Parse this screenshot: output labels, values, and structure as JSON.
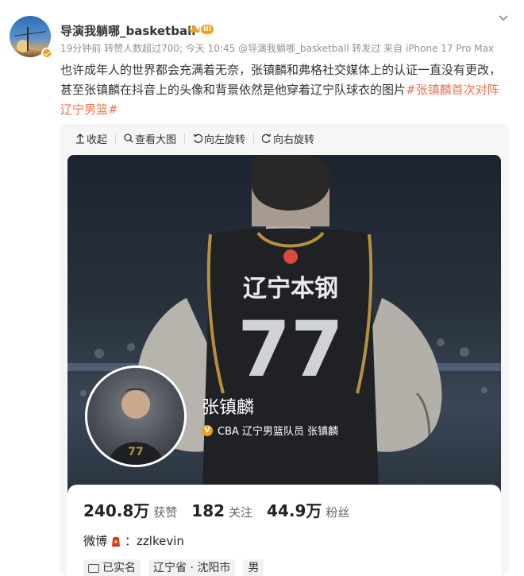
{
  "post": {
    "username": "导演我躺哪_basketball",
    "level_badge": "III",
    "meta": "19分钟前 转赞人数超过700; 今天 10:45 @导演我躺哪_basketball 转发过  来自 iPhone 17 Pro Max",
    "text": "也许成年人的世界都会充满着无奈，张镇麟和弗格社交媒体上的认证一直没有更改，甚至张镇麟在抖音上的头像和背景依然是他穿着辽宁队球衣的图片",
    "hashtag": "#张镇麟首次对阵辽宁男篮#"
  },
  "toolbar": {
    "collapse": "收起",
    "view_large": "查看大图",
    "rotate_left": "向左旋转",
    "rotate_right": "向右旋转"
  },
  "jersey": {
    "team_text": "辽宁本钢",
    "number": "77"
  },
  "profile": {
    "name": "张镇麟",
    "verification": "CBA 辽宁男篮队员 张镇麟",
    "stats": [
      {
        "value": "240.8万",
        "label": "获赞"
      },
      {
        "value": "182",
        "label": "关注"
      },
      {
        "value": "44.9万",
        "label": "粉丝"
      }
    ],
    "weibo_label": "微博",
    "weibo_id": "zzlkevin",
    "tags": [
      "已实名",
      "辽宁省 · 沈阳市",
      "男"
    ]
  },
  "colors": {
    "hashtag": "#eb7350",
    "verified_badge": "#f39a1e"
  }
}
